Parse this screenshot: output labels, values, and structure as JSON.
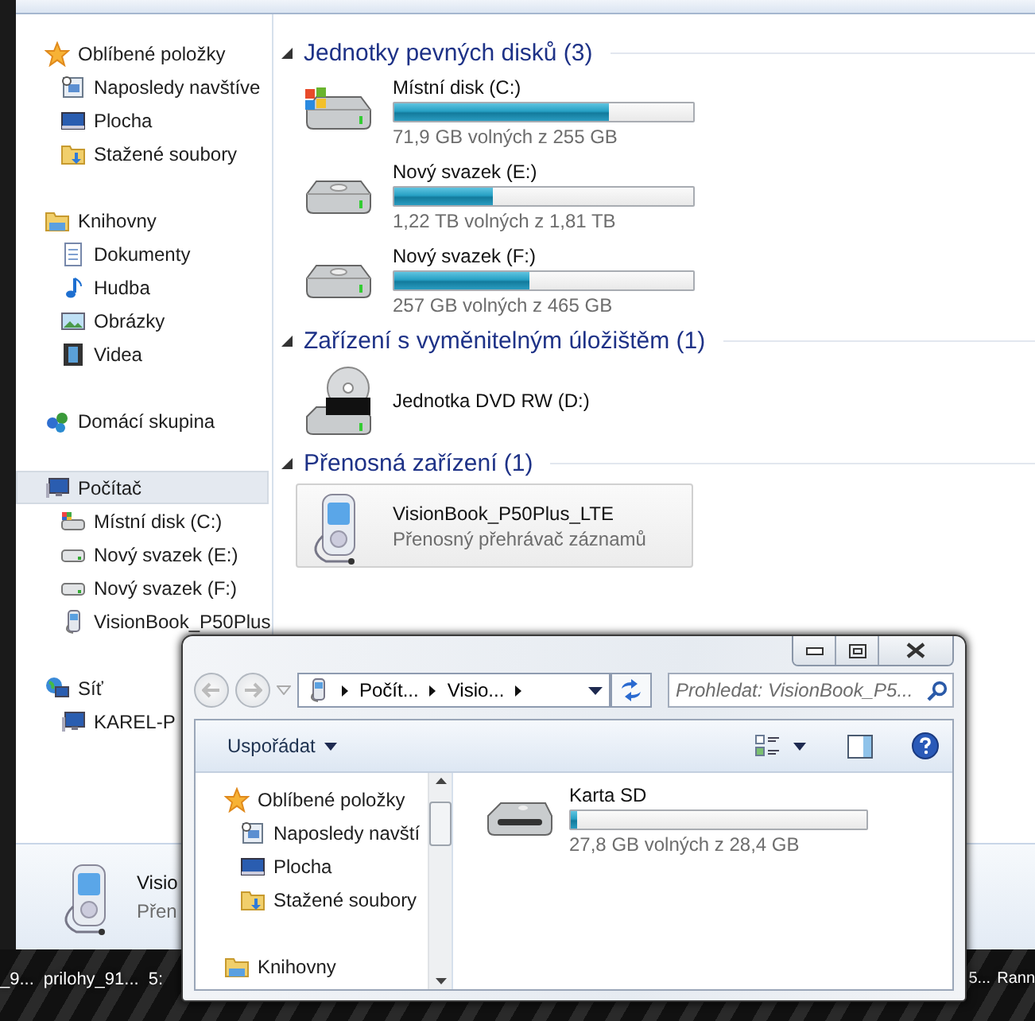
{
  "back_window": {
    "sidebar": {
      "groups": [
        {
          "kind": "favorites",
          "label": "Oblíbené položky",
          "selected": false,
          "children": [
            {
              "kind": "recent",
              "label": "Naposledy navštíve",
              "selected": false
            },
            {
              "kind": "desktop",
              "label": "Plocha",
              "selected": false
            },
            {
              "kind": "downloads",
              "label": "Stažené soubory",
              "selected": false
            }
          ]
        },
        {
          "kind": "library",
          "label": "Knihovny",
          "selected": false,
          "children": [
            {
              "kind": "documents",
              "label": "Dokumenty",
              "selected": false
            },
            {
              "kind": "music",
              "label": "Hudba",
              "selected": false
            },
            {
              "kind": "pictures",
              "label": "Obrázky",
              "selected": false
            },
            {
              "kind": "videos",
              "label": "Videa",
              "selected": false
            }
          ]
        },
        {
          "kind": "homegroup",
          "label": "Domácí skupina",
          "selected": false
        },
        {
          "kind": "computer",
          "label": "Počítač",
          "selected": true,
          "children": [
            {
              "kind": "system_drive",
              "label": "Místní disk (C:)",
              "selected": false
            },
            {
              "kind": "drive",
              "label": "Nový svazek (E:)",
              "selected": false
            },
            {
              "kind": "drive",
              "label": "Nový svazek (F:)",
              "selected": false
            },
            {
              "kind": "player",
              "label": "VisionBook_P50Plus",
              "selected": false
            }
          ]
        },
        {
          "kind": "network",
          "label": "Síť",
          "selected": false,
          "children": [
            {
              "kind": "computer",
              "label": "KAREL-P",
              "selected": false
            }
          ]
        }
      ]
    },
    "sections": [
      {
        "title": "Jednotky pevných disků (3)",
        "expanded": true,
        "items": [
          {
            "kind": "system_drive",
            "name": "Místní disk (C:)",
            "level": 0.72,
            "free": "71,9 GB volných z 255 GB",
            "hovered": false
          },
          {
            "kind": "drive",
            "name": "Nový svazek (E:)",
            "level": 0.33,
            "free": "1,22 TB volných z 1,81 TB",
            "hovered": false
          },
          {
            "kind": "drive",
            "name": "Nový svazek (F:)",
            "level": 0.45,
            "free": "257 GB volných z 465 GB",
            "hovered": false
          }
        ]
      },
      {
        "title": "Zařízení s vyměnitelným úložištěm (1)",
        "expanded": true,
        "items": [
          {
            "kind": "dvd",
            "name": "Jednotka DVD RW (D:)",
            "hovered": false
          }
        ]
      },
      {
        "title": "Přenosná zařízení (1)",
        "expanded": true,
        "items": [
          {
            "kind": "player",
            "name": "VisionBook_P50Plus_LTE",
            "subtitle": "Přenosný přehrávač záznamů",
            "hovered": true
          }
        ]
      }
    ],
    "details": {
      "name": "Visio",
      "subtitle": "Přen"
    }
  },
  "front_window": {
    "address": {
      "crumbs": [
        "Počít...",
        "Visio..."
      ]
    },
    "search": {
      "placeholder": "Prohledat: VisionBook_P5..."
    },
    "toolbar": {
      "organize": "Uspořádat"
    },
    "nav": {
      "groups": [
        {
          "kind": "favorites",
          "label": "Oblíbené položky",
          "selected": false,
          "children": [
            {
              "kind": "recent",
              "label": "Naposledy navští",
              "selected": false
            },
            {
              "kind": "desktop",
              "label": "Plocha",
              "selected": false
            },
            {
              "kind": "downloads",
              "label": "Stažené soubory",
              "selected": false
            }
          ]
        },
        {
          "kind": "library",
          "label": "Knihovny",
          "selected": false
        }
      ]
    },
    "items": [
      {
        "kind": "sd",
        "name": "Karta SD",
        "level": 0.02,
        "free": "27,8 GB volných z 28,4 GB"
      }
    ]
  },
  "taskbar": {
    "left_items": [
      "_9...",
      "prilohy_91...",
      "5:"
    ],
    "right_items": [
      "5...",
      "Rann"
    ]
  }
}
